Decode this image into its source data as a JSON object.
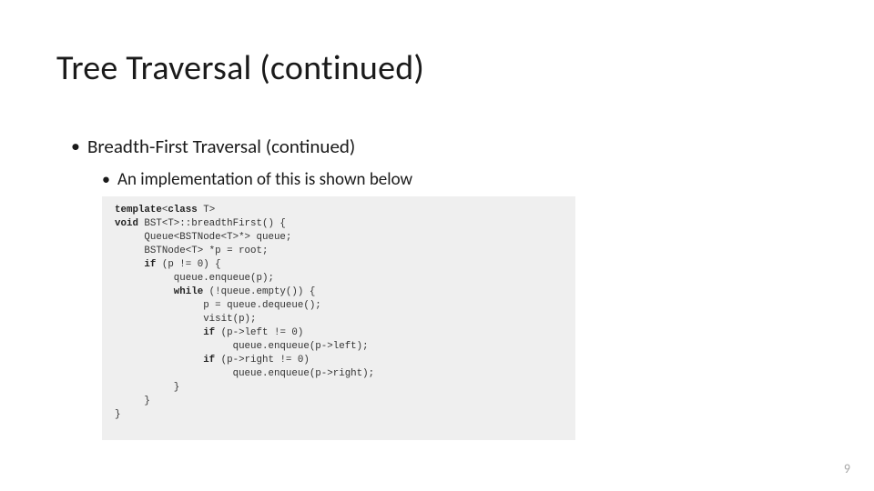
{
  "title": "Tree Traversal (continued)",
  "bullet1": "Breadth-First Traversal (continued)",
  "bullet2": "An implementation of this is shown below",
  "page_number": "9",
  "code": {
    "l01a": "template",
    "l01b": "<",
    "l01c": "class",
    "l01d": " T>",
    "l02a": "void",
    "l02b": " BST<T>::breadthFirst() {",
    "l03": "     Queue<BSTNode<T>*> queue;",
    "l04": "     BSTNode<T> *p = root;",
    "l05a": "     ",
    "l05b": "if",
    "l05c": " (p != 0) {",
    "l06": "          queue.enqueue(p);",
    "l07a": "          ",
    "l07b": "while",
    "l07c": " (!queue.empty()) {",
    "l08": "               p = queue.dequeue();",
    "l09": "               visit(p);",
    "l10a": "               ",
    "l10b": "if",
    "l10c": " (p->left != 0)",
    "l11": "                    queue.enqueue(p->left);",
    "l12a": "               ",
    "l12b": "if",
    "l12c": " (p->right != 0)",
    "l13": "                    queue.enqueue(p->right);",
    "l14": "          }",
    "l15": "     }",
    "l16": "}"
  }
}
